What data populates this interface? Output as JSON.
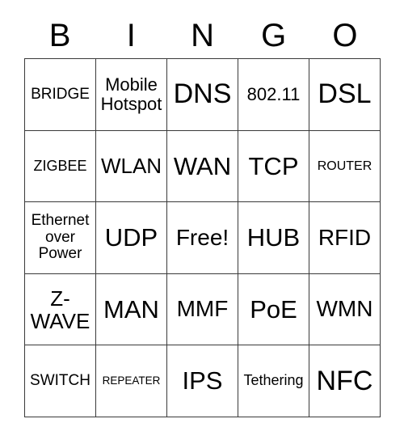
{
  "card": {
    "title": "BINGO",
    "header_letters": [
      "B",
      "I",
      "N",
      "G",
      "O"
    ],
    "border_color": "#3a3a3a",
    "background_color": "#ffffff",
    "text_color": "#000000",
    "rows": [
      [
        {
          "label": "BRIDGE",
          "size": "fs-xs"
        },
        {
          "label": "Mobile Hotspot",
          "size": "fs-s"
        },
        {
          "label": "DNS",
          "size": "fs-xxl"
        },
        {
          "label": "802.11",
          "size": "fs-s"
        },
        {
          "label": "DSL",
          "size": "fs-xxl"
        }
      ],
      [
        {
          "label": "ZIGBEE",
          "size": "fs-xxs"
        },
        {
          "label": "WLAN",
          "size": "fs-m"
        },
        {
          "label": "WAN",
          "size": "fs-xl"
        },
        {
          "label": "TCP",
          "size": "fs-xl"
        },
        {
          "label": "ROUTER",
          "size": "fs-tiny"
        }
      ],
      [
        {
          "label": "Ethernet over Power",
          "size": "fs-xs"
        },
        {
          "label": "UDP",
          "size": "fs-xl"
        },
        {
          "label": "Free!",
          "size": "fs-l"
        },
        {
          "label": "HUB",
          "size": "fs-xl"
        },
        {
          "label": "RFID",
          "size": "fs-l"
        }
      ],
      [
        {
          "label": "Z-WAVE",
          "size": "fs-m"
        },
        {
          "label": "MAN",
          "size": "fs-xl"
        },
        {
          "label": "MMF",
          "size": "fs-l"
        },
        {
          "label": "PoE",
          "size": "fs-xl"
        },
        {
          "label": "WMN",
          "size": "fs-l"
        }
      ],
      [
        {
          "label": "SWITCH",
          "size": "fs-xs"
        },
        {
          "label": "REPEATER",
          "size": "fs-min"
        },
        {
          "label": "IPS",
          "size": "fs-xl"
        },
        {
          "label": "Tethering",
          "size": "fs-xxs"
        },
        {
          "label": "NFC",
          "size": "fs-xxl"
        }
      ]
    ]
  }
}
